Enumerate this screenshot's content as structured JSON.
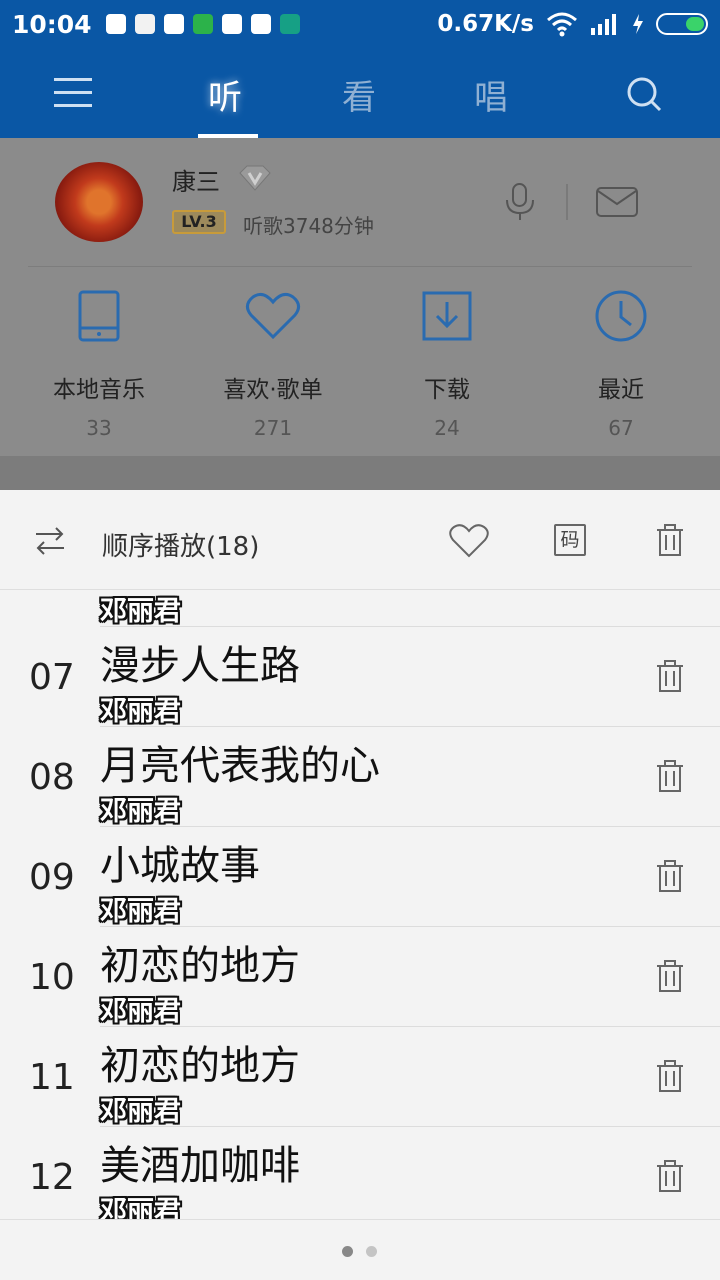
{
  "status_bar": {
    "time": "10:04",
    "net_speed": "0.67K/s",
    "icons": [
      "shield-icon",
      "shopping-icon",
      "security-icon",
      "android-icon",
      "k-app-icon",
      "shield-icon",
      "wifi-shield-icon"
    ]
  },
  "nav": {
    "tabs": [
      {
        "label": "听",
        "active": true
      },
      {
        "label": "看",
        "active": false
      },
      {
        "label": "唱",
        "active": false
      }
    ]
  },
  "profile": {
    "name": "康三",
    "level": "LV.3",
    "listen_time": "听歌3748分钟"
  },
  "quick_access": [
    {
      "label": "本地音乐",
      "count": "33",
      "icon": "phone-icon"
    },
    {
      "label": "喜欢·歌单",
      "count": "271",
      "icon": "heart-icon"
    },
    {
      "label": "下载",
      "count": "24",
      "icon": "download-icon"
    },
    {
      "label": "最近",
      "count": "67",
      "icon": "clock-icon"
    }
  ],
  "playlist": {
    "mode_label": "顺序播放(18)",
    "code_label": "码",
    "partial_artist": "邓丽君",
    "songs": [
      {
        "num": "07",
        "title": "漫步人生路",
        "artist": "邓丽君"
      },
      {
        "num": "08",
        "title": "月亮代表我的心",
        "artist": "邓丽君"
      },
      {
        "num": "09",
        "title": "小城故事",
        "artist": "邓丽君"
      },
      {
        "num": "10",
        "title": "初恋的地方",
        "artist": "邓丽君"
      },
      {
        "num": "11",
        "title": "初恋的地方",
        "artist": "邓丽君"
      },
      {
        "num": "12",
        "title": "美酒加咖啡",
        "artist": "邓丽君"
      }
    ]
  },
  "pager": {
    "pages": 2,
    "current": 1
  },
  "colors": {
    "nav_bg": "#0a57a5",
    "accent_blue": "#1e6fb8",
    "overlay_gray": "#8b8b8b"
  }
}
